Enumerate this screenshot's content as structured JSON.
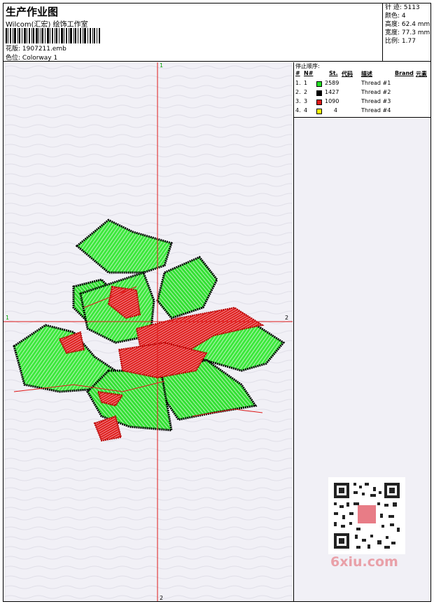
{
  "header": {
    "title": "生产作业图",
    "company": "Wilcom(汇宏) 绘饰工作室",
    "file_label": "花版:",
    "file_name": "1907211.emb",
    "color_label": "色位:",
    "colorway": "Colorway 1"
  },
  "stats": {
    "stitches": "针 迹: 5113",
    "colors": "颜色: 4",
    "height": "高度: 62.4 mm",
    "width": "宽度: 77.3 mm",
    "scale": "比例: 1.77"
  },
  "thread_table": {
    "title": "停止顺序:",
    "headers": {
      "hash": "#",
      "n": "N#",
      "st": "St.",
      "code": "代码",
      "desc": "描述",
      "brand": "Brand",
      "element": "元素"
    },
    "rows": [
      {
        "num": "1.",
        "n": "1",
        "st": "2589",
        "color": "#22e022",
        "desc": "Thread #1"
      },
      {
        "num": "2.",
        "n": "2",
        "st": "1427",
        "color": "#000000",
        "desc": "Thread #2"
      },
      {
        "num": "3.",
        "n": "3",
        "st": "1090",
        "color": "#e01a1a",
        "desc": "Thread #3"
      },
      {
        "num": "4.",
        "n": "4",
        "st": "4",
        "color": "#ffff00",
        "desc": "Thread #4"
      }
    ]
  },
  "axes": {
    "v_top": "1",
    "v_bottom": "2",
    "h_left": "1",
    "h_right": "2"
  },
  "watermark": {
    "text": "6xiu.com"
  }
}
